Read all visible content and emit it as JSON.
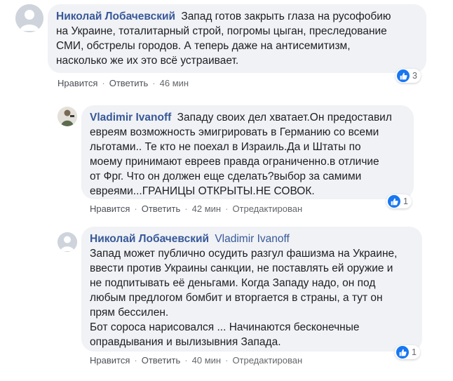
{
  "accent_color": "#385898",
  "bubble_color": "#f0f2f5",
  "like_color": "#1877f2",
  "comments": [
    {
      "author": "Николай Лобачевский",
      "text": "Запад готов закрыть глаза на русофобию\nна Украине, тоталитарный строй, погромы цыган, преследование\nСМИ, обстрелы городов. А теперь даже на антисемитизм,\nнасколько же их это всё устраивает.",
      "like_label": "Нравится",
      "reply_label": "Ответить",
      "time": "46 мин",
      "reaction_count": "3",
      "reaction_icon": "like-icon"
    },
    {
      "author": "Vladimir Ivanoff",
      "text": "Западу своих дел хватает.Он предоставил\nевреям возможность эмигрировать в Германию со всеми\nльготами.. Те кто не поехал в Израиль.Да и Штаты по\nмоему принимают евреев правда ограниченно.в отличие\nот Фрг. Что он должен еще сделать?выбор за самими\nевреями...ГРАНИЦЫ ОТКРЫТЫ.НЕ СОВОК.",
      "like_label": "Нравится",
      "reply_label": "Ответить",
      "time": "42 мин",
      "edited": "Отредактирован",
      "reaction_count": "1",
      "reaction_icon": "like-icon"
    },
    {
      "author": "Николай Лобачевский",
      "mention": "Vladimir Ivanoff",
      "text": "Запад может публично осудить разгул фашизма на Украине,\nввести против Украины санкции, не поставлять ей оружие и\nне подпитывать её деньгами. Когда Западу надо, он под\nлюбым предлогом бомбит и вторгается в страны, а тут он\nпрям бессилен.\nБот сороса нарисовался ... Начинаются бесконечные\nоправдывания и вылизывния Запада.",
      "like_label": "Нравится",
      "reply_label": "Ответить",
      "time": "40 мин",
      "edited": "Отредактирован",
      "reaction_count": "1",
      "reaction_icon": "like-icon"
    }
  ]
}
